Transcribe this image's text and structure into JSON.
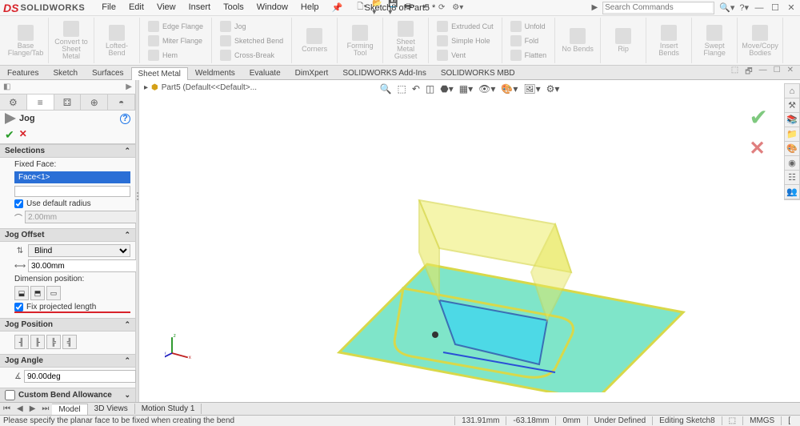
{
  "app": {
    "logo_text": "SOLIDWORKS"
  },
  "menu": {
    "file": "File",
    "edit": "Edit",
    "view": "View",
    "insert": "Insert",
    "tools": "Tools",
    "window": "Window",
    "help": "Help"
  },
  "doc_title": "Sketch8 of Part5 *",
  "search": {
    "placeholder": "Search Commands"
  },
  "ribbon": {
    "base_flange": "Base Flange/Tab",
    "convert": "Convert to Sheet Metal",
    "lofted": "Lofted-Bend",
    "edge_flange": "Edge Flange",
    "miter_flange": "Miter Flange",
    "hem": "Hem",
    "jog": "Jog",
    "sketched_bend": "Sketched Bend",
    "cross_break": "Cross-Break",
    "corners": "Corners",
    "forming_tool": "Forming Tool",
    "gusset": "Sheet Metal Gusset",
    "extruded_cut": "Extruded Cut",
    "simple_hole": "Simple Hole",
    "vent": "Vent",
    "unfold": "Unfold",
    "fold": "Fold",
    "flatten": "Flatten",
    "no_bends": "No Bends",
    "rip": "Rip",
    "insert_bends": "Insert Bends",
    "swept_flange": "Swept Flange",
    "movecopy": "Move/Copy Bodies"
  },
  "tabs": {
    "features": "Features",
    "sketch": "Sketch",
    "surfaces": "Surfaces",
    "sheet_metal": "Sheet Metal",
    "weldments": "Weldments",
    "evaluate": "Evaluate",
    "dimxpert": "DimXpert",
    "addins": "SOLIDWORKS Add-Ins",
    "mbd": "SOLIDWORKS MBD"
  },
  "tree_node": "Part5  (Default<<Default>...",
  "pm": {
    "title": "Jog",
    "sec_selections": "Selections",
    "fixed_face": "Fixed Face:",
    "face1": "Face<1>",
    "use_default_radius": "Use default radius",
    "radius_val": "2.00mm",
    "sec_jog_offset": "Jog Offset",
    "end_condition": "Blind",
    "offset_val": "30.00mm",
    "dim_pos": "Dimension position:",
    "fix_proj": "Fix projected length",
    "sec_jog_position": "Jog Position",
    "sec_jog_angle": "Jog Angle",
    "angle_val": "90.00deg",
    "sec_custom_bend": "Custom Bend Allowance"
  },
  "bottom_tabs": {
    "model": "Model",
    "views3d": "3D Views",
    "motion": "Motion Study 1"
  },
  "status": {
    "message": "Please specify the planar face to be fixed when creating the bend",
    "x": "131.91mm",
    "y": "-63.18mm",
    "z": "0mm",
    "defined": "Under Defined",
    "editing": "Editing Sketch8",
    "units": "MMGS"
  }
}
